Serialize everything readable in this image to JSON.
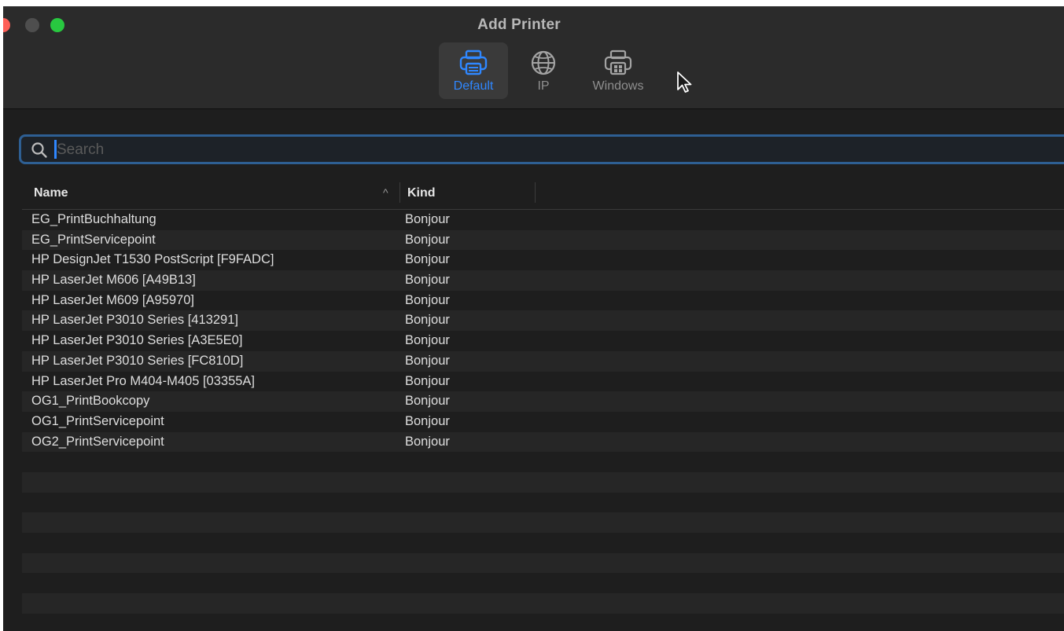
{
  "window": {
    "title": "Add Printer"
  },
  "toolbar": {
    "tabs": [
      {
        "label": "Default",
        "icon": "printer-icon",
        "selected": true
      },
      {
        "label": "IP",
        "icon": "globe-icon",
        "selected": false
      },
      {
        "label": "Windows",
        "icon": "windows-printer-icon",
        "selected": false
      }
    ]
  },
  "search": {
    "placeholder": "Search",
    "value": ""
  },
  "table": {
    "columns": [
      {
        "label": "Name",
        "sort": "ascending"
      },
      {
        "label": "Kind"
      }
    ],
    "rows": [
      {
        "name": "EG_PrintBuchhaltung",
        "kind": "Bonjour"
      },
      {
        "name": "EG_PrintServicepoint",
        "kind": "Bonjour"
      },
      {
        "name": "HP DesignJet T1530 PostScript [F9FADC]",
        "kind": "Bonjour"
      },
      {
        "name": "HP LaserJet M606 [A49B13]",
        "kind": "Bonjour"
      },
      {
        "name": "HP LaserJet M609 [A95970]",
        "kind": "Bonjour"
      },
      {
        "name": "HP LaserJet P3010 Series [413291]",
        "kind": "Bonjour"
      },
      {
        "name": "HP LaserJet P3010 Series [A3E5E0]",
        "kind": "Bonjour"
      },
      {
        "name": "HP LaserJet P3010 Series [FC810D]",
        "kind": "Bonjour"
      },
      {
        "name": "HP LaserJet Pro M404-M405 [03355A]",
        "kind": "Bonjour"
      },
      {
        "name": "OG1_PrintBookcopy",
        "kind": "Bonjour"
      },
      {
        "name": "OG1_PrintServicepoint",
        "kind": "Bonjour"
      },
      {
        "name": "OG2_PrintServicepoint",
        "kind": "Bonjour"
      }
    ]
  },
  "colors": {
    "accent": "#2f87ff",
    "window_bg": "#1e1e1e",
    "toolbar_bg": "#2b2b2b"
  }
}
